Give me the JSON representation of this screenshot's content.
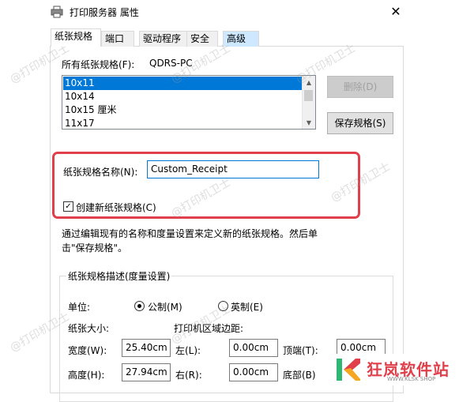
{
  "window": {
    "title": "打印服务器 属性",
    "close_glyph": "✕"
  },
  "tabs": [
    {
      "label": "纸张规格"
    },
    {
      "label": "端口"
    },
    {
      "label": "驱动程序"
    },
    {
      "label": "安全"
    },
    {
      "label": "高级"
    }
  ],
  "forms": {
    "all_label": "所有纸张规格(F):",
    "server_name": "QDRS-PC",
    "list": [
      "10x11",
      "10x14",
      "10x15 厘米",
      "11x17"
    ],
    "selected_index": 0,
    "delete_button": "删除(D)",
    "save_button": "保存规格(S)",
    "name_label": "纸张规格名称(N):",
    "name_value": "Custom_Receipt",
    "create_checkbox_label": "创建新纸张规格(C)",
    "create_checked": true,
    "description": "通过编辑现有的名称和度量设置来定义新的纸张规格。然后单击\"保存规格\"。"
  },
  "group": {
    "title": "纸张规格描述(度量设置)",
    "unit_label": "单位:",
    "metric_label": "公制(M)",
    "imperial_label": "英制(E)",
    "metric_selected": true,
    "paper_size_label": "纸张大小:",
    "margins_label": "打印机区域边距:",
    "width_label": "宽度(W):",
    "width_value": "25.40cm",
    "left_label": "左(L):",
    "left_value": "0.00cm",
    "top_label": "顶端(T):",
    "top_value": "0.00cm",
    "height_label": "高度(H):",
    "height_value": "27.94cm",
    "right_label": "右(R):",
    "right_value": "0.00cm",
    "bottom_label": "底部(B)"
  },
  "watermark": {
    "text": "@打印机卫士"
  },
  "logo": {
    "text": "狂岚软件站",
    "sub": "WWW.KLSK SHOP",
    "accent": "#e0404b"
  },
  "colors": {
    "selection": "#0078d7",
    "highlight_box": "#e0404b"
  }
}
